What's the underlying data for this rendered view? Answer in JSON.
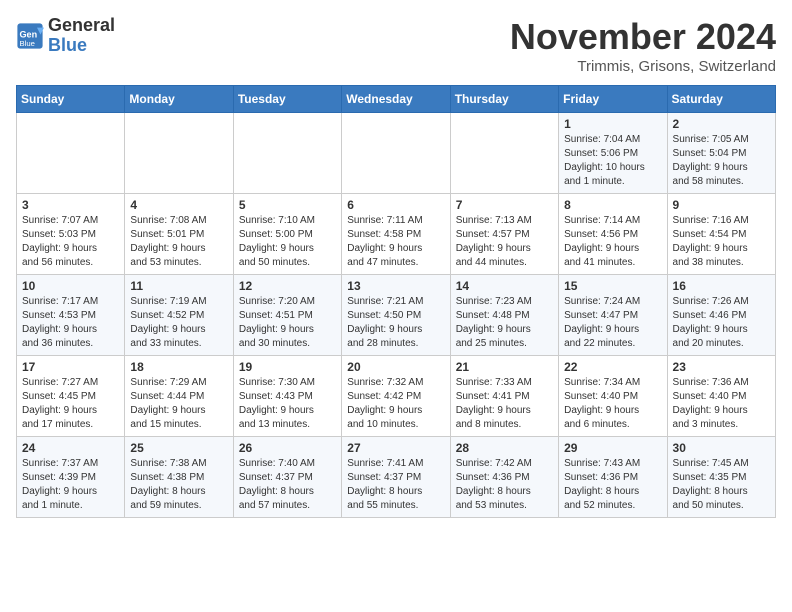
{
  "header": {
    "logo_line1": "General",
    "logo_line2": "Blue",
    "month_title": "November 2024",
    "location": "Trimmis, Grisons, Switzerland"
  },
  "weekdays": [
    "Sunday",
    "Monday",
    "Tuesday",
    "Wednesday",
    "Thursday",
    "Friday",
    "Saturday"
  ],
  "weeks": [
    [
      {
        "day": "",
        "info": ""
      },
      {
        "day": "",
        "info": ""
      },
      {
        "day": "",
        "info": ""
      },
      {
        "day": "",
        "info": ""
      },
      {
        "day": "",
        "info": ""
      },
      {
        "day": "1",
        "info": "Sunrise: 7:04 AM\nSunset: 5:06 PM\nDaylight: 10 hours\nand 1 minute."
      },
      {
        "day": "2",
        "info": "Sunrise: 7:05 AM\nSunset: 5:04 PM\nDaylight: 9 hours\nand 58 minutes."
      }
    ],
    [
      {
        "day": "3",
        "info": "Sunrise: 7:07 AM\nSunset: 5:03 PM\nDaylight: 9 hours\nand 56 minutes."
      },
      {
        "day": "4",
        "info": "Sunrise: 7:08 AM\nSunset: 5:01 PM\nDaylight: 9 hours\nand 53 minutes."
      },
      {
        "day": "5",
        "info": "Sunrise: 7:10 AM\nSunset: 5:00 PM\nDaylight: 9 hours\nand 50 minutes."
      },
      {
        "day": "6",
        "info": "Sunrise: 7:11 AM\nSunset: 4:58 PM\nDaylight: 9 hours\nand 47 minutes."
      },
      {
        "day": "7",
        "info": "Sunrise: 7:13 AM\nSunset: 4:57 PM\nDaylight: 9 hours\nand 44 minutes."
      },
      {
        "day": "8",
        "info": "Sunrise: 7:14 AM\nSunset: 4:56 PM\nDaylight: 9 hours\nand 41 minutes."
      },
      {
        "day": "9",
        "info": "Sunrise: 7:16 AM\nSunset: 4:54 PM\nDaylight: 9 hours\nand 38 minutes."
      }
    ],
    [
      {
        "day": "10",
        "info": "Sunrise: 7:17 AM\nSunset: 4:53 PM\nDaylight: 9 hours\nand 36 minutes."
      },
      {
        "day": "11",
        "info": "Sunrise: 7:19 AM\nSunset: 4:52 PM\nDaylight: 9 hours\nand 33 minutes."
      },
      {
        "day": "12",
        "info": "Sunrise: 7:20 AM\nSunset: 4:51 PM\nDaylight: 9 hours\nand 30 minutes."
      },
      {
        "day": "13",
        "info": "Sunrise: 7:21 AM\nSunset: 4:50 PM\nDaylight: 9 hours\nand 28 minutes."
      },
      {
        "day": "14",
        "info": "Sunrise: 7:23 AM\nSunset: 4:48 PM\nDaylight: 9 hours\nand 25 minutes."
      },
      {
        "day": "15",
        "info": "Sunrise: 7:24 AM\nSunset: 4:47 PM\nDaylight: 9 hours\nand 22 minutes."
      },
      {
        "day": "16",
        "info": "Sunrise: 7:26 AM\nSunset: 4:46 PM\nDaylight: 9 hours\nand 20 minutes."
      }
    ],
    [
      {
        "day": "17",
        "info": "Sunrise: 7:27 AM\nSunset: 4:45 PM\nDaylight: 9 hours\nand 17 minutes."
      },
      {
        "day": "18",
        "info": "Sunrise: 7:29 AM\nSunset: 4:44 PM\nDaylight: 9 hours\nand 15 minutes."
      },
      {
        "day": "19",
        "info": "Sunrise: 7:30 AM\nSunset: 4:43 PM\nDaylight: 9 hours\nand 13 minutes."
      },
      {
        "day": "20",
        "info": "Sunrise: 7:32 AM\nSunset: 4:42 PM\nDaylight: 9 hours\nand 10 minutes."
      },
      {
        "day": "21",
        "info": "Sunrise: 7:33 AM\nSunset: 4:41 PM\nDaylight: 9 hours\nand 8 minutes."
      },
      {
        "day": "22",
        "info": "Sunrise: 7:34 AM\nSunset: 4:40 PM\nDaylight: 9 hours\nand 6 minutes."
      },
      {
        "day": "23",
        "info": "Sunrise: 7:36 AM\nSunset: 4:40 PM\nDaylight: 9 hours\nand 3 minutes."
      }
    ],
    [
      {
        "day": "24",
        "info": "Sunrise: 7:37 AM\nSunset: 4:39 PM\nDaylight: 9 hours\nand 1 minute."
      },
      {
        "day": "25",
        "info": "Sunrise: 7:38 AM\nSunset: 4:38 PM\nDaylight: 8 hours\nand 59 minutes."
      },
      {
        "day": "26",
        "info": "Sunrise: 7:40 AM\nSunset: 4:37 PM\nDaylight: 8 hours\nand 57 minutes."
      },
      {
        "day": "27",
        "info": "Sunrise: 7:41 AM\nSunset: 4:37 PM\nDaylight: 8 hours\nand 55 minutes."
      },
      {
        "day": "28",
        "info": "Sunrise: 7:42 AM\nSunset: 4:36 PM\nDaylight: 8 hours\nand 53 minutes."
      },
      {
        "day": "29",
        "info": "Sunrise: 7:43 AM\nSunset: 4:36 PM\nDaylight: 8 hours\nand 52 minutes."
      },
      {
        "day": "30",
        "info": "Sunrise: 7:45 AM\nSunset: 4:35 PM\nDaylight: 8 hours\nand 50 minutes."
      }
    ]
  ]
}
